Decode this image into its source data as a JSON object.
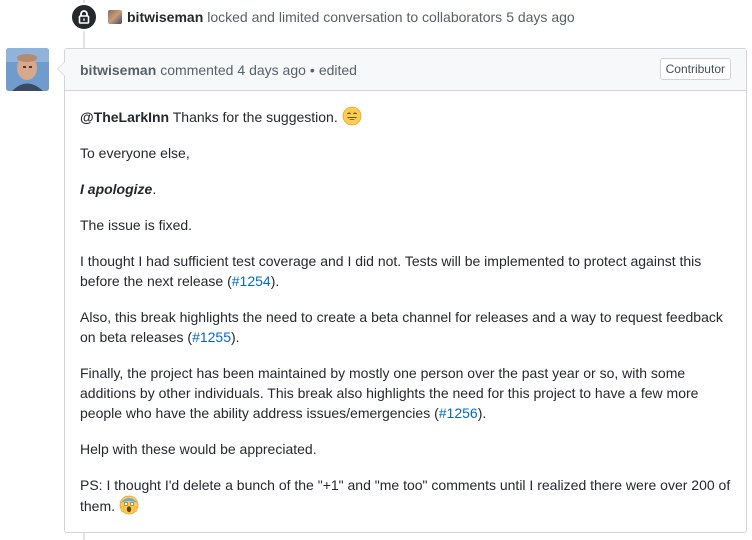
{
  "event": {
    "actor": "bitwiseman",
    "action": "locked and limited conversation to collaborators",
    "time": "5 days ago",
    "icon": "lock-icon"
  },
  "comment": {
    "author": "bitwiseman",
    "action": "commented",
    "time": "4 days ago",
    "separator": "•",
    "edited": "edited",
    "badge": "Contributor",
    "body": {
      "p1_mention": "@TheLarkInn",
      "p1_text": " Thanks for the suggestion. ",
      "p1_emoji": "smile-emoji",
      "p2": "To everyone else,",
      "p3_em": "I apologize",
      "p3_end": ".",
      "p4": "The issue is fixed.",
      "p5_text": "I thought I had sufficient test coverage and I did not. Tests will be implemented to protect against this before the next release (",
      "p5_link": "#1254",
      "p5_end": ").",
      "p6_text": "Also, this break highlights the need to create a beta channel for releases and a way to request feedback on beta releases (",
      "p6_link": "#1255",
      "p6_end": ").",
      "p7_text": "Finally, the project has been maintained by mostly one person over the past year or so, with some additions by other individuals. This break also highlights the need for this project to have a few more people who have the ability address issues/emergencies (",
      "p7_link": "#1256",
      "p7_end": ").",
      "p8": "Help with these would be appreciated.",
      "p9_text": "PS: I thought I'd delete a bunch of the \"+1\" and \"me too\" comments until I realized there were over 200 of them. ",
      "p9_emoji": "scream-emoji"
    }
  },
  "colors": {
    "link": "#0366d6",
    "header_bg": "#f6f8fa",
    "border": "#d1d5da",
    "badge_dark": "#24292e"
  }
}
